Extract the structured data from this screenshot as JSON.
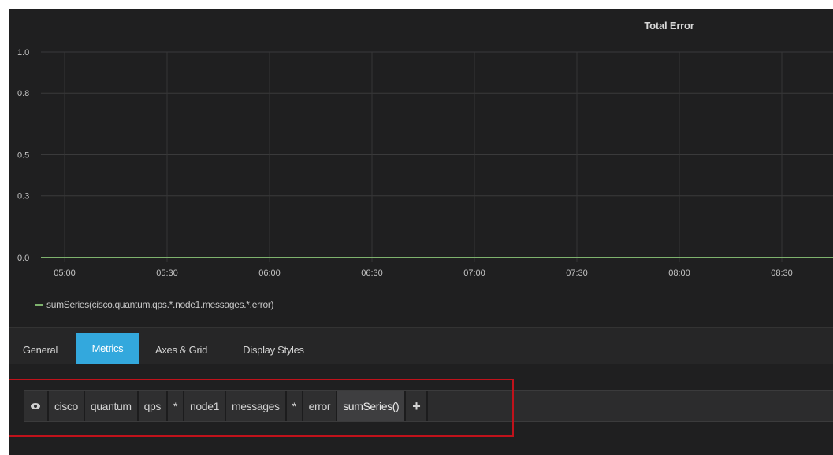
{
  "panel": {
    "title": "Total Error",
    "legend": "sumSeries(cisco.quantum.qps.*.node1.messages.*.error)"
  },
  "chart_data": {
    "type": "line",
    "title": "Total Error",
    "xlabel": "",
    "ylabel": "",
    "x_ticks": [
      "05:00",
      "05:30",
      "06:00",
      "06:30",
      "07:00",
      "07:30",
      "08:00",
      "08:30"
    ],
    "y_ticks": [
      "1.0",
      "0.8",
      "0.5",
      "0.3",
      "0.0"
    ],
    "ylim": [
      0,
      1
    ],
    "grid": true,
    "series": [
      {
        "name": "sumSeries(cisco.quantum.qps.*.node1.messages.*.error)",
        "color": "#7eb26d",
        "x": [
          "05:00",
          "05:30",
          "06:00",
          "06:30",
          "07:00",
          "07:30",
          "08:00",
          "08:30"
        ],
        "values": [
          0,
          0,
          0,
          0,
          0,
          0,
          0,
          0
        ]
      }
    ]
  },
  "tabs": [
    {
      "label": "General",
      "active": false
    },
    {
      "label": "Metrics",
      "active": true
    },
    {
      "label": "Axes & Grid",
      "active": false
    },
    {
      "label": "Display Styles",
      "active": false
    }
  ],
  "query": {
    "segments": [
      "cisco",
      "quantum",
      "qps",
      "*",
      "node1",
      "messages",
      "*",
      "error"
    ],
    "function": "sumSeries()",
    "add": "+"
  },
  "colors": {
    "background": "#1f1f20",
    "series": "#7eb26d",
    "active_tab": "#33a8dd",
    "highlight": "#c0121b"
  }
}
